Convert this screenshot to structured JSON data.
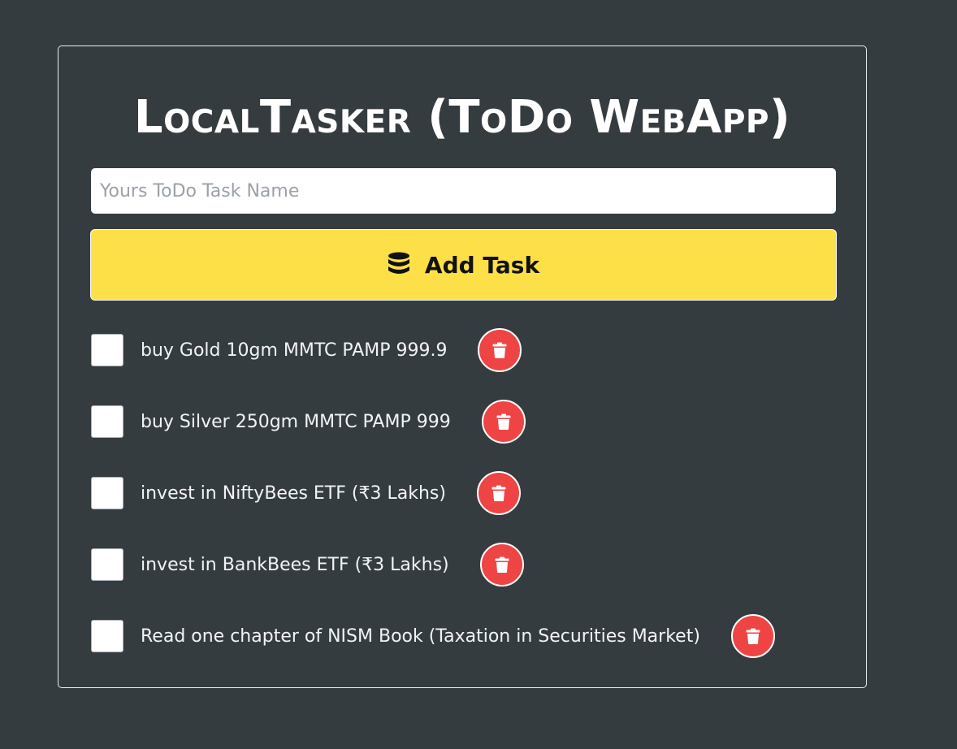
{
  "app": {
    "title": "LocalTasker (ToDo WebApp)"
  },
  "task_input": {
    "placeholder": "Yours ToDo Task Name",
    "value": ""
  },
  "add_button": {
    "label": "Add Task",
    "icon": "database-icon"
  },
  "tasks": [
    {
      "text": "buy Gold 10gm MMTC PAMP 999.9",
      "checked": false
    },
    {
      "text": "buy Silver 250gm MMTC PAMP 999",
      "checked": false
    },
    {
      "text": "invest in NiftyBees ETF (₹3 Lakhs)",
      "checked": false
    },
    {
      "text": "invest in BankBees ETF (₹3 Lakhs)",
      "checked": false
    },
    {
      "text": "Read one chapter of NISM Book (Taxation in Securities Market)",
      "checked": false
    }
  ],
  "colors": {
    "background": "#353c40",
    "accent": "#fde047",
    "danger": "#ef4444"
  }
}
